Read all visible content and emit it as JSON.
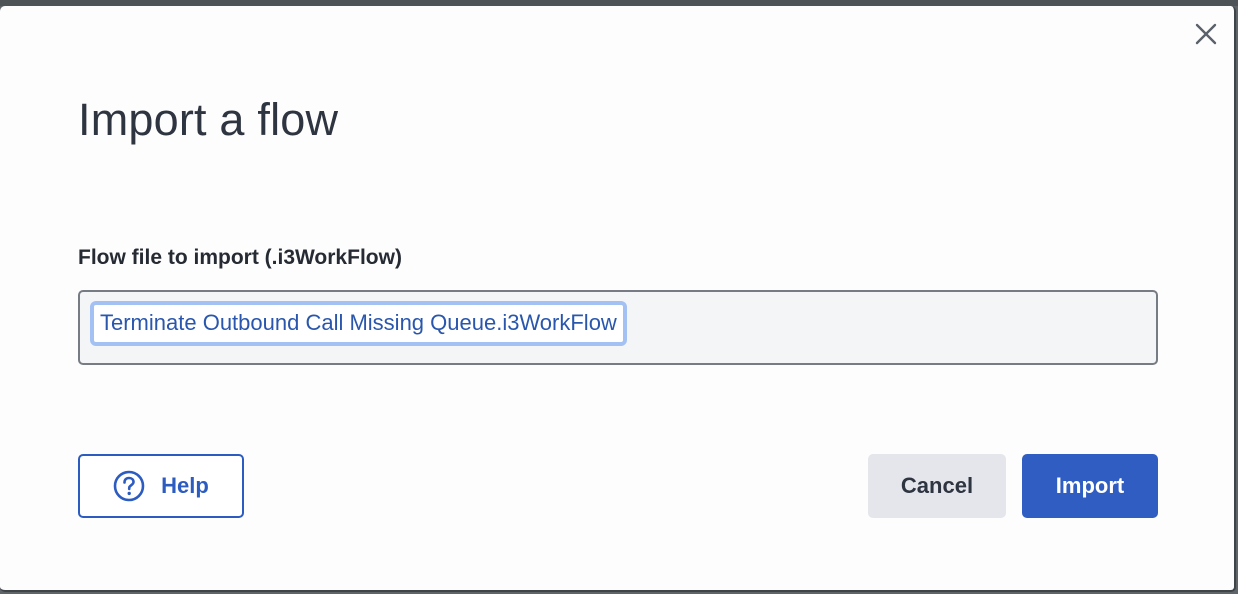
{
  "dialog": {
    "title": "Import a flow",
    "close_icon": "close-icon"
  },
  "file_field": {
    "label": "Flow file to import (.i3WorkFlow)",
    "value": "Terminate Outbound Call Missing Queue.i3WorkFlow"
  },
  "buttons": {
    "help_label": "Help",
    "help_icon": "question-circle-icon",
    "cancel_label": "Cancel",
    "import_label": "Import"
  },
  "colors": {
    "primary": "#2f5dc2",
    "file_highlight": "#a4c1f4",
    "secondary_button": "#e4e6ec"
  }
}
